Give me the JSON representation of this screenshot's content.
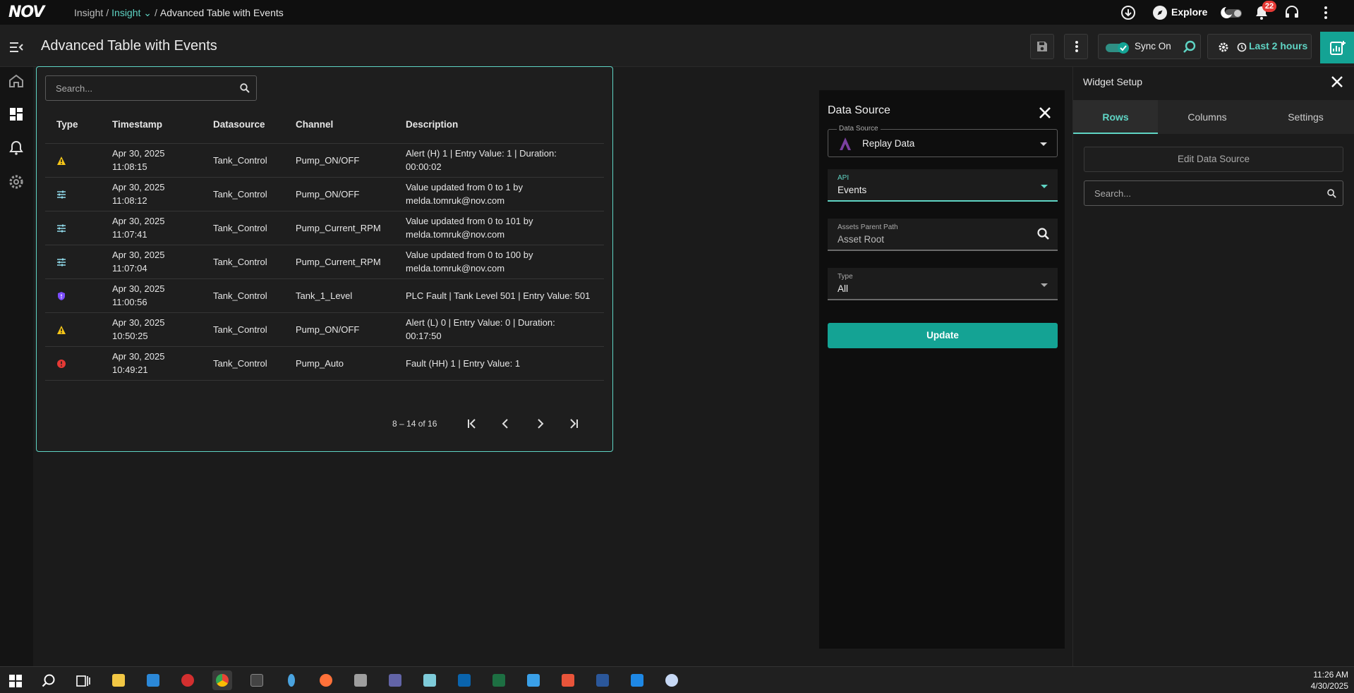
{
  "topbar": {
    "logo": "NOV",
    "breadcrumb": [
      {
        "label": "Insight"
      },
      {
        "label": "Insight"
      },
      {
        "label": "Advanced Table with Events"
      }
    ],
    "explore_label": "Explore",
    "notification_count": "22"
  },
  "toolbar": {
    "title": "Advanced Table with Events",
    "sync_label": "Sync On",
    "time_range": "Last 2 hours"
  },
  "table": {
    "search_placeholder": "Search...",
    "columns": [
      "Type",
      "Timestamp",
      "Datasource",
      "Channel",
      "Description"
    ],
    "rows": [
      {
        "type": "warning",
        "ts1": "Apr 30, 2025",
        "ts2": "11:08:15",
        "datasource": "Tank_Control",
        "channel": "Pump_ON/OFF",
        "d1": "Alert (H) 1 | Entry Value: 1 | Duration:",
        "d2": "00:00:02"
      },
      {
        "type": "tune",
        "ts1": "Apr 30, 2025",
        "ts2": "11:08:12",
        "datasource": "Tank_Control",
        "channel": "Pump_ON/OFF",
        "d1": "Value updated from 0 to 1 by",
        "d2": "melda.tomruk@nov.com"
      },
      {
        "type": "tune",
        "ts1": "Apr 30, 2025",
        "ts2": "11:07:41",
        "datasource": "Tank_Control",
        "channel": "Pump_Current_RPM",
        "d1": "Value updated from 0 to 101 by",
        "d2": "melda.tomruk@nov.com"
      },
      {
        "type": "tune",
        "ts1": "Apr 30, 2025",
        "ts2": "11:07:04",
        "datasource": "Tank_Control",
        "channel": "Pump_Current_RPM",
        "d1": "Value updated from 0 to 100 by",
        "d2": "melda.tomruk@nov.com"
      },
      {
        "type": "shield",
        "ts1": "Apr 30, 2025",
        "ts2": "11:00:56",
        "datasource": "Tank_Control",
        "channel": "Tank_1_Level",
        "d1": "PLC Fault | Tank Level 501 | Entry Value: 501",
        "d2": ""
      },
      {
        "type": "warning",
        "ts1": "Apr 30, 2025",
        "ts2": "10:50:25",
        "datasource": "Tank_Control",
        "channel": "Pump_ON/OFF",
        "d1": "Alert (L) 0 | Entry Value: 0 | Duration:",
        "d2": "00:17:50"
      },
      {
        "type": "error",
        "ts1": "Apr 30, 2025",
        "ts2": "10:49:21",
        "datasource": "Tank_Control",
        "channel": "Pump_Auto",
        "d1": "Fault (HH) 1 | Entry Value: 1",
        "d2": ""
      }
    ],
    "pagination": "8 – 14 of 16"
  },
  "data_source_panel": {
    "title": "Data Source",
    "source_label": "Data Source",
    "source_value": "Replay Data",
    "api_label": "API",
    "api_value": "Events",
    "path_label": "Assets Parent Path",
    "path_value": "Asset Root",
    "type_label": "Type",
    "type_value": "All",
    "update_label": "Update"
  },
  "widget_setup": {
    "title": "Widget Setup",
    "tabs": [
      "Rows",
      "Columns",
      "Settings"
    ],
    "edit_ds_label": "Edit Data Source",
    "search_placeholder": "Search..."
  },
  "taskbar": {
    "time": "11:26 AM",
    "date": "4/30/2025"
  },
  "colors": {
    "accent": "#5fd4c4",
    "primary_button": "#14a394",
    "warning": "#f5c518",
    "error": "#e53935",
    "shield": "#7c4dff"
  }
}
